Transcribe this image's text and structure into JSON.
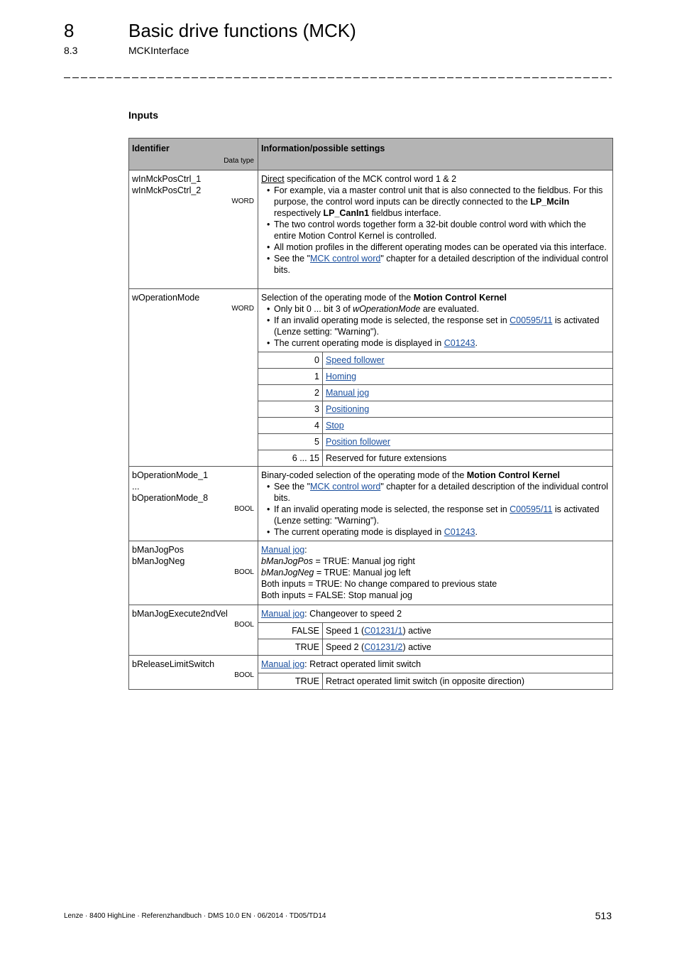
{
  "header": {
    "chapter_number": "8",
    "chapter_title": "Basic drive functions (MCK)",
    "section_number": "8.3",
    "section_title": "MCKInterface"
  },
  "subheading": "Inputs",
  "table": {
    "col_identifier": "Identifier",
    "col_datatype": "Data type",
    "col_info": "Information/possible settings",
    "rows": [
      {
        "identifiers": [
          "wInMckPosCtrl_1",
          "wInMckPosCtrl_2"
        ],
        "datatype": "WORD",
        "lead_link": "Direct",
        "lead_text": " specification of the MCK control word 1 & 2",
        "bullets": {
          "b1_a": "For example, via a master control unit that is also connected to the fieldbus. For this purpose, the control word inputs can be directly connected to the ",
          "b1_bold1": "LP_MciIn",
          "b1_b": " respectively ",
          "b1_bold2": "LP_CanIn1",
          "b1_c": " fieldbus interface.",
          "b2": "The two control words together form a 32-bit double control word with which the entire Motion Control Kernel is controlled.",
          "b3": "All motion profiles in the different operating modes can be operated via this interface.",
          "b4_a": "See the \"",
          "b4_link": "MCK control word",
          "b4_b": "\" chapter for a detailed description of the individual control bits."
        }
      },
      {
        "identifiers": [
          "wOperationMode"
        ],
        "datatype": "WORD",
        "lead_text": "Selection of the operating mode of the ",
        "lead_bold": "Motion Control Kernel",
        "bullets": {
          "b1_a": "Only bit 0 ... bit 3 of ",
          "b1_italic": "wOperationMode",
          "b1_b": " are evaluated.",
          "b2_a": "If an invalid operating mode is selected, the response set in ",
          "b2_link": "C00595/11",
          "b2_b": " is activated (Lenze setting: \"Warning\").",
          "b3_a": "The current operating mode is displayed in ",
          "b3_link": "C01243",
          "b3_b": "."
        },
        "values": [
          {
            "value": "0",
            "label": "Speed follower",
            "link": true
          },
          {
            "value": "1",
            "label": "Homing",
            "link": true
          },
          {
            "value": "2",
            "label": "Manual jog",
            "link": true
          },
          {
            "value": "3",
            "label": "Positioning",
            "link": true
          },
          {
            "value": "4",
            "label": "Stop",
            "link": true
          },
          {
            "value": "5",
            "label": "Position follower",
            "link": true
          },
          {
            "value": "6 ... 15",
            "label": "Reserved for future extensions",
            "link": false
          }
        ]
      },
      {
        "identifiers": [
          "bOperationMode_1",
          "...",
          "bOperationMode_8"
        ],
        "datatype": "BOOL",
        "lead_text": "Binary-coded selection of the operating mode of the ",
        "lead_bold": "Motion Control Kernel",
        "bullets": {
          "b1_a": "See the \"",
          "b1_link": "MCK control word",
          "b1_b": "\" chapter for a detailed description of the individual control bits.",
          "b2_a": "If an invalid operating mode is selected, the response set in ",
          "b2_link": "C00595/11",
          "b2_b": " is activated (Lenze setting: \"Warning\").",
          "b3_a": "The current operating mode is displayed in ",
          "b3_link": "C01243",
          "b3_b": "."
        }
      },
      {
        "identifiers": [
          "bManJogPos",
          "bManJogNeg"
        ],
        "datatype": "BOOL",
        "lead_link": "Manual jog",
        "lead_text": ":",
        "lines": {
          "l1_italic": "bManJogPos",
          "l1_text": " = TRUE: Manual jog right",
          "l2_italic": "bManJogNeg",
          "l2_text": " = TRUE: Manual jog left",
          "l3": "Both inputs = TRUE: No change compared to previous state",
          "l4": "Both inputs = FALSE: Stop manual jog"
        }
      },
      {
        "identifiers": [
          "bManJogExecute2ndVel"
        ],
        "datatype": "BOOL",
        "lead_link": "Manual jog",
        "lead_text": ": Changeover to speed 2",
        "values": [
          {
            "value": "FALSE",
            "pre": "Speed 1 (",
            "link": "C01231/1",
            "post": ") active"
          },
          {
            "value": "TRUE",
            "pre": "Speed 2 (",
            "link": "C01231/2",
            "post": ") active"
          }
        ]
      },
      {
        "identifiers": [
          "bReleaseLimitSwitch"
        ],
        "datatype": "BOOL",
        "lead_link": "Manual jog",
        "lead_text": ": Retract operated limit switch",
        "values": [
          {
            "value": "TRUE",
            "label": "Retract operated limit switch (in opposite direction)"
          }
        ]
      }
    ]
  },
  "footer": {
    "left": "Lenze · 8400 HighLine · Referenzhandbuch · DMS 10.0 EN · 06/2014 · TD05/TD14",
    "page_number": "513"
  },
  "colors": {
    "header_bg": "#b4b4b4",
    "link": "#1a4f9e"
  }
}
